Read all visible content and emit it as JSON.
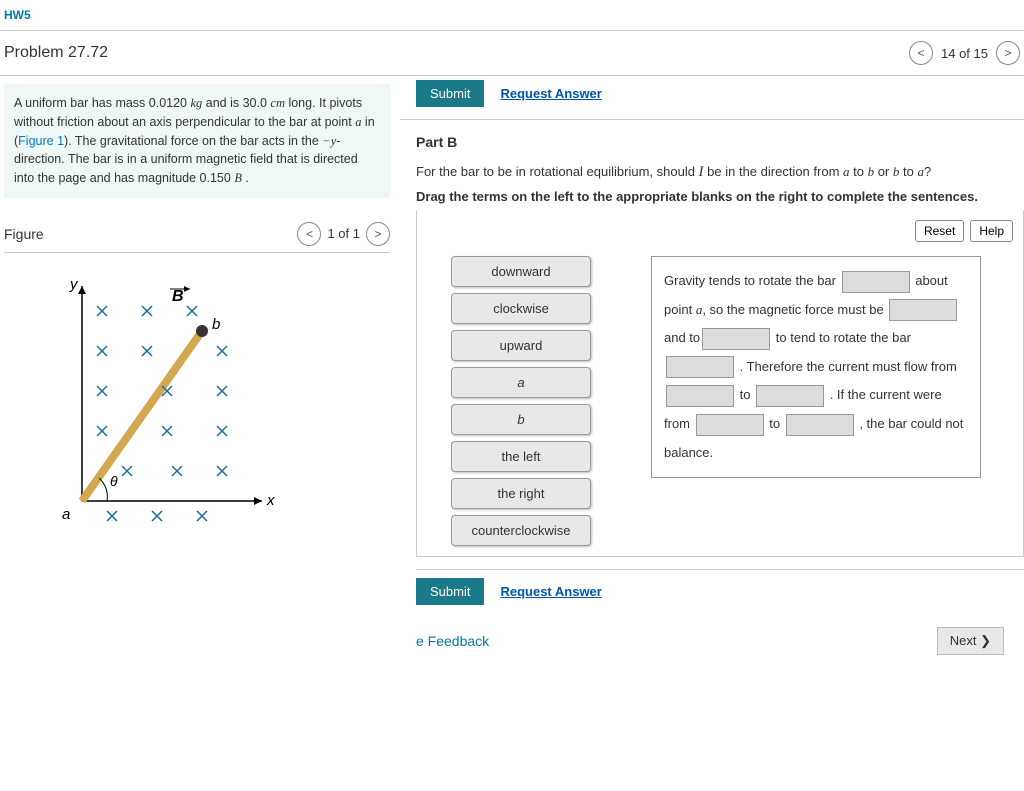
{
  "top_link": "HW5",
  "problem_title": "Problem 27.72",
  "page_indicator": "14 of 15",
  "submit_label": "Submit",
  "request_answer_label": "Request Answer",
  "problem_text_prefix": "A uniform bar has mass 0.0120 ",
  "unit_kg": "kg",
  "problem_text_mid1": " and is 30.0 ",
  "unit_cm": "cm",
  "problem_text_mid2": " long. It pivots without friction about an axis perpendicular to the bar at point ",
  "var_a": "a",
  "problem_text_mid3": " in (",
  "fig_link": "Figure 1",
  "problem_text_mid4": "). The gravitational force on the bar acts in the ",
  "minus_y": "−y",
  "problem_text_mid5": "-direction. The bar is in a uniform magnetic field that is directed into the page and has magnitude 0.150 ",
  "unit_B": "B",
  "period": " .",
  "part_b_label": "Part B",
  "part_b_q_prefix": "For the bar to be in rotational equilibrium, should ",
  "var_I": "I",
  "part_b_q_mid": " be in the direction from ",
  "var_to": " to ",
  "var_b": "b",
  "var_or": " or ",
  "part_b_q_end": "?",
  "drag_instruction": "Drag the terms on the left to the appropriate blanks on the right to complete the sentences.",
  "reset_label": "Reset",
  "help_label": "Help",
  "terms": {
    "t1": "downward",
    "t2": "clockwise",
    "t3": "upward",
    "t4": "a",
    "t5": "b",
    "t6": "the left",
    "t7": "the right",
    "t8": "counterclockwise"
  },
  "sentence": {
    "s1": "Gravity tends to rotate the bar ",
    "s2": "about point ",
    "s2b": ", so the magnetic force must be ",
    "s3": " and to",
    "s3b": " to tend to rotate the bar ",
    "s4": " . Therefore the current must flow from ",
    "s5": " to ",
    "s6": " . If the current were from ",
    "s7": " to ",
    "s8": " , the bar could not balance."
  },
  "figure_title": "Figure",
  "figure_page": "1 of 1",
  "feedback_label": "e Feedback",
  "next_label": "Next ❯",
  "axis_y": "y",
  "axis_x": "x",
  "label_B": "B",
  "label_b": "b",
  "label_a": "a",
  "label_theta": "θ"
}
